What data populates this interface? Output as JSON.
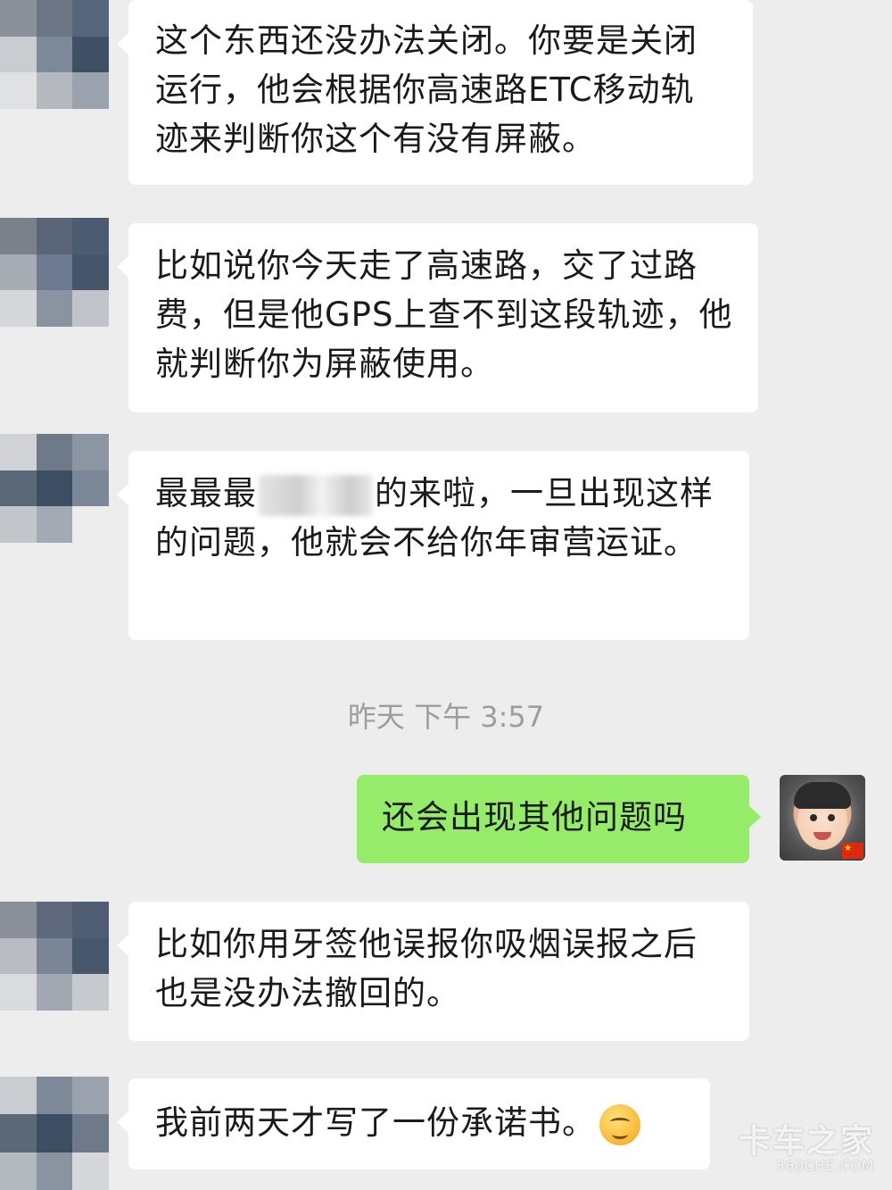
{
  "messages": [
    {
      "text": "这个东西还没办法关闭。你要是关闭运行，他会根据你高速路ETC移动轨迹来判断你这个有没有屏蔽。"
    },
    {
      "text": "比如说你今天走了高速路，交了过路费，但是他GPS上查不到这段轨迹，他就判断你为屏蔽使用。"
    },
    {
      "text_before": "最最最",
      "text_after": "的来啦，一旦出现这样的问题，他就会不给你年审营运证。"
    },
    {
      "text": "还会出现其他问题吗"
    },
    {
      "text": "比如你用牙签他误报你吸烟误报之后也是没办法撤回的。"
    },
    {
      "text": "我前两天才写了一份承诺书。",
      "emoji": "smirk-emoji"
    }
  ],
  "timestamp": "昨天 下午 3:57",
  "watermark": {
    "line1": "卡车之家",
    "line2": "360CHE.COM"
  },
  "colors": {
    "background": "#ededed",
    "incoming_bubble": "#ffffff",
    "outgoing_bubble": "#95ec69",
    "timestamp": "#9d9d9d"
  }
}
